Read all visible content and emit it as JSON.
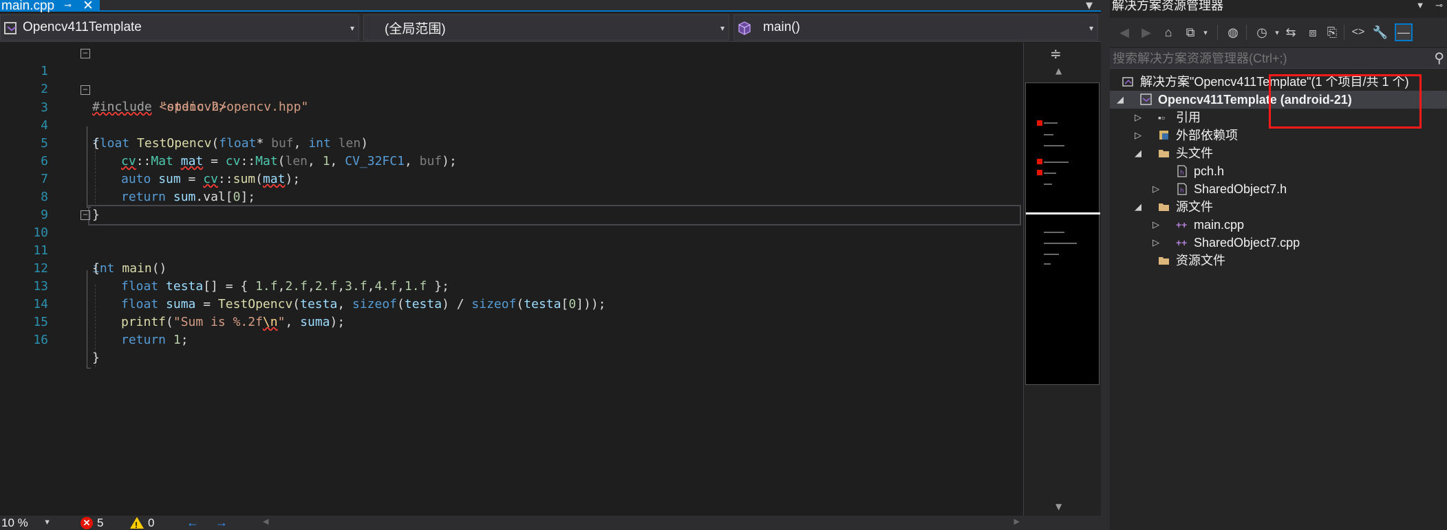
{
  "editor": {
    "tab": {
      "label": "main.cpp",
      "pin": "⊸",
      "close": "✕"
    },
    "navbar": {
      "project": "Opencv411Template",
      "scope": "(全局范围)",
      "function": "main()"
    },
    "lines": [
      {
        "n": "1"
      },
      {
        "n": "2"
      },
      {
        "n": "3"
      },
      {
        "n": "4"
      },
      {
        "n": "5"
      },
      {
        "n": "6"
      },
      {
        "n": "7"
      },
      {
        "n": "8"
      },
      {
        "n": "9"
      },
      {
        "n": "10"
      },
      {
        "n": "11"
      },
      {
        "n": "12"
      },
      {
        "n": "13"
      },
      {
        "n": "14"
      },
      {
        "n": "15"
      },
      {
        "n": "16"
      }
    ],
    "code": {
      "l1": {
        "a": "#include",
        "b": " \"opencv2/opencv.hpp\""
      },
      "l2": {
        "a": "#include",
        "b": " <stdio.h>"
      },
      "l3": {
        "a": "float",
        "b": " ",
        "c": "TestOpencv",
        "d": "(",
        "e": "float",
        "f": "* ",
        "g": "buf",
        "h": ", ",
        "i": "int",
        "j": " ",
        "k": "len",
        "m": ")"
      },
      "l4": "{",
      "l5": {
        "a": "cv",
        "b": "::",
        "c": "Mat",
        "d": " ",
        "e": "mat",
        "f": " = ",
        "g": "cv",
        "h": "::",
        "i": "Mat",
        "j": "(",
        "k": "len",
        "m": ", ",
        "n": "1",
        "o": ", ",
        "p": "CV_32FC1",
        "q": ", ",
        "r": "buf",
        "s": ");"
      },
      "l6": {
        "a": "auto",
        "b": " ",
        "c": "sum",
        "d": " = ",
        "e": "cv",
        "f": "::",
        "g": "sum",
        "h": "(",
        "i": "mat",
        "j": ");"
      },
      "l7": {
        "a": "return",
        "b": " ",
        "c": "sum",
        "d": ".",
        "e": "val",
        "f": "[",
        "g": "0",
        "h": "];"
      },
      "l8": "}",
      "l10": {
        "a": "int",
        "b": " ",
        "c": "main",
        "d": "()"
      },
      "l11": "{",
      "l12": {
        "a": "float",
        "b": " ",
        "c": "testa",
        "d": "[] = { ",
        "e": "1.f",
        "f": ",",
        "g": "2.f",
        "h": ",",
        "i": "2.f",
        "j": ",",
        "k": "3.f",
        "m": ",",
        "n": "4.f",
        "o": ",",
        "p": "1.f",
        "q": " };"
      },
      "l13": {
        "a": "float",
        "b": " ",
        "c": "suma",
        "d": " = ",
        "e": "TestOpencv",
        "f": "(",
        "g": "testa",
        "h": ", ",
        "i": "sizeof",
        "j": "(",
        "k": "testa",
        "m": ") / ",
        "n": "sizeof",
        "o": "(",
        "p": "testa",
        "q": "[",
        "r": "0",
        "s": "]));"
      },
      "l14": {
        "a": "printf",
        "b": "(",
        "c": "\"Sum is %.2f",
        "d": "\\n",
        "e": "\"",
        "f": ", ",
        "g": "suma",
        "h": ");"
      },
      "l15": {
        "a": "return",
        "b": " ",
        "c": "1",
        "d": ";"
      },
      "l16": "}"
    }
  },
  "statusbar": {
    "zoom": "10 %",
    "errors": "5",
    "warnings": "0"
  },
  "solution_explorer": {
    "title": "解决方案资源管理器",
    "search_placeholder": "搜索解决方案资源管理器(Ctrl+;)",
    "items": [
      {
        "label": "解决方案\"Opencv411Template\"(1 个项目/共 1 个)"
      },
      {
        "label": "Opencv411Template (android-21)"
      },
      {
        "label": "引用"
      },
      {
        "label": "外部依赖项"
      },
      {
        "label": "头文件"
      },
      {
        "label": "pch.h"
      },
      {
        "label": "SharedObject7.h"
      },
      {
        "label": "源文件"
      },
      {
        "label": "main.cpp"
      },
      {
        "label": "SharedObject7.cpp"
      },
      {
        "label": "资源文件"
      }
    ]
  },
  "colors": {
    "accent": "#007acc",
    "error": "#e51400",
    "warning": "#ffcc00",
    "highlight_box": "#ff1a1a",
    "line_number": "#2b91af",
    "keyword": "#569cd6"
  }
}
